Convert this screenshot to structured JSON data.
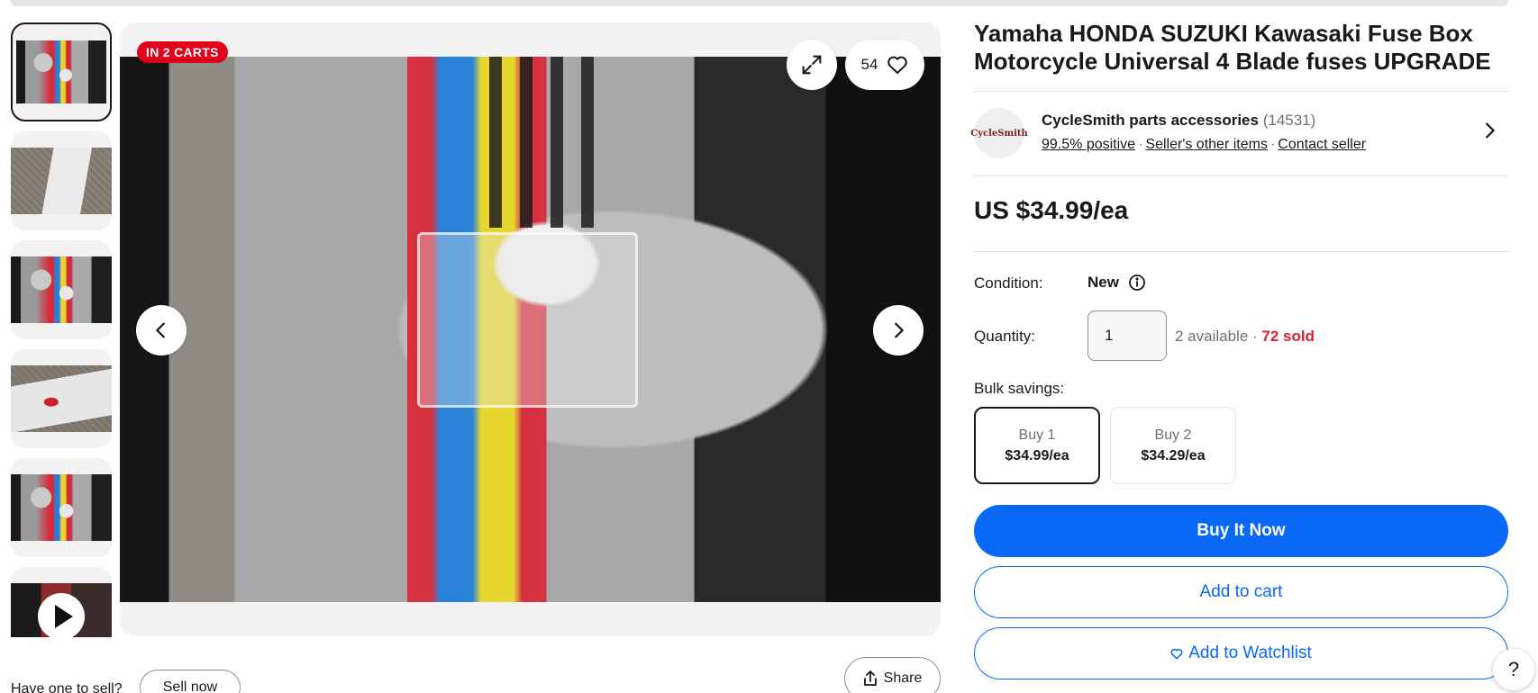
{
  "gallery": {
    "badge": "IN 2 CARTS",
    "watchers_count": "54",
    "thumbnails": [
      {
        "icon": "engine-photo",
        "selected": true
      },
      {
        "icon": "package-photo"
      },
      {
        "icon": "engine-photo"
      },
      {
        "icon": "package-photo"
      },
      {
        "icon": "engine-photo"
      },
      {
        "icon": "video-thumbnail"
      }
    ]
  },
  "sell": {
    "prompt": "Have one to sell?",
    "button": "Sell now"
  },
  "share": {
    "label": "Share"
  },
  "listing": {
    "title": "Yamaha HONDA SUZUKI Kawasaki Fuse Box Motorcycle Universal 4 Blade fuses UPGRADE",
    "price": "US $34.99/ea"
  },
  "seller": {
    "logo_text": "CycleSmith",
    "name": "CycleSmith parts accessories",
    "feedback_count": "(14531)",
    "positive": "99.5% positive",
    "other_items": "Seller's other items",
    "contact": "Contact seller"
  },
  "condition": {
    "label": "Condition:",
    "value": "New"
  },
  "quantity": {
    "label": "Quantity:",
    "value": "1",
    "available": "2 available",
    "separator": "·",
    "sold": "72 sold"
  },
  "bulk": {
    "label": "Bulk savings:",
    "options": [
      {
        "qty": "Buy 1",
        "price": "$34.99/ea",
        "selected": true
      },
      {
        "qty": "Buy 2",
        "price": "$34.29/ea",
        "selected": false
      }
    ]
  },
  "actions": {
    "buy_now": "Buy It Now",
    "add_to_cart": "Add to cart",
    "watchlist": "Add to Watchlist"
  },
  "help": {
    "label": "?"
  },
  "colors": {
    "primary_blue": "#0968f6",
    "badge_red": "#e0001b",
    "sold_red": "#dd1e31"
  }
}
